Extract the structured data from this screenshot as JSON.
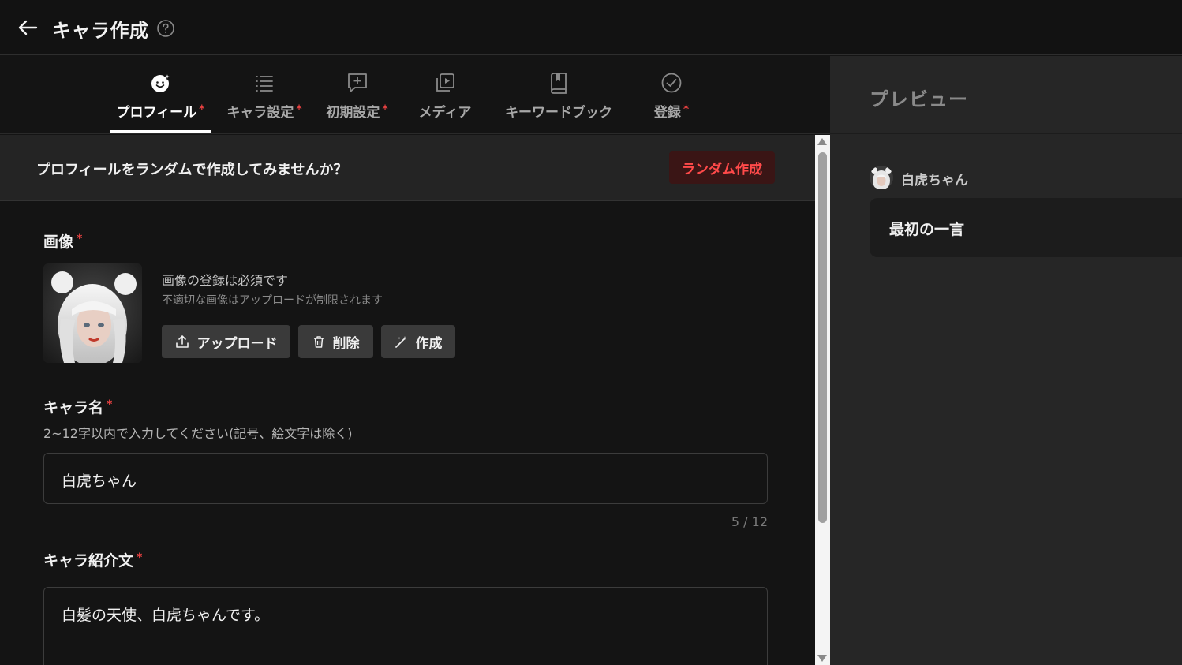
{
  "header": {
    "title": "キャラ作成"
  },
  "tabs": [
    {
      "label": "プロフィール",
      "required": "*"
    },
    {
      "label": "キャラ設定",
      "required": "*"
    },
    {
      "label": "初期設定",
      "required": "*"
    },
    {
      "label": "メディア",
      "required": ""
    },
    {
      "label": "キーワードブック",
      "required": ""
    },
    {
      "label": "登録",
      "required": "*"
    }
  ],
  "banner": {
    "text": "プロフィールをランダムで作成してみませんか？",
    "button": "ランダム作成"
  },
  "image_section": {
    "label": "画像",
    "note": "画像の登録は必須です",
    "subnote": "不適切な画像はアップロードが制限されます",
    "upload": "アップロード",
    "delete": "削除",
    "create": "作成"
  },
  "name_section": {
    "label": "キャラ名",
    "hint": "2~12字以内で入力してください(記号、絵文字は除く)",
    "value": "白虎ちゃん",
    "counter": "5 / 12"
  },
  "intro_section": {
    "label": "キャラ紹介文",
    "value": "白髪の天使、白虎ちゃんです。"
  },
  "preview": {
    "title": "プレビュー",
    "name": "白虎ちゃん",
    "message": "最初の一言"
  },
  "required_mark": "*",
  "colors": {
    "accent_red": "#e84141",
    "random_button_text": "#ff4a4a",
    "background": "#141414",
    "preview_bg": "#262626"
  }
}
